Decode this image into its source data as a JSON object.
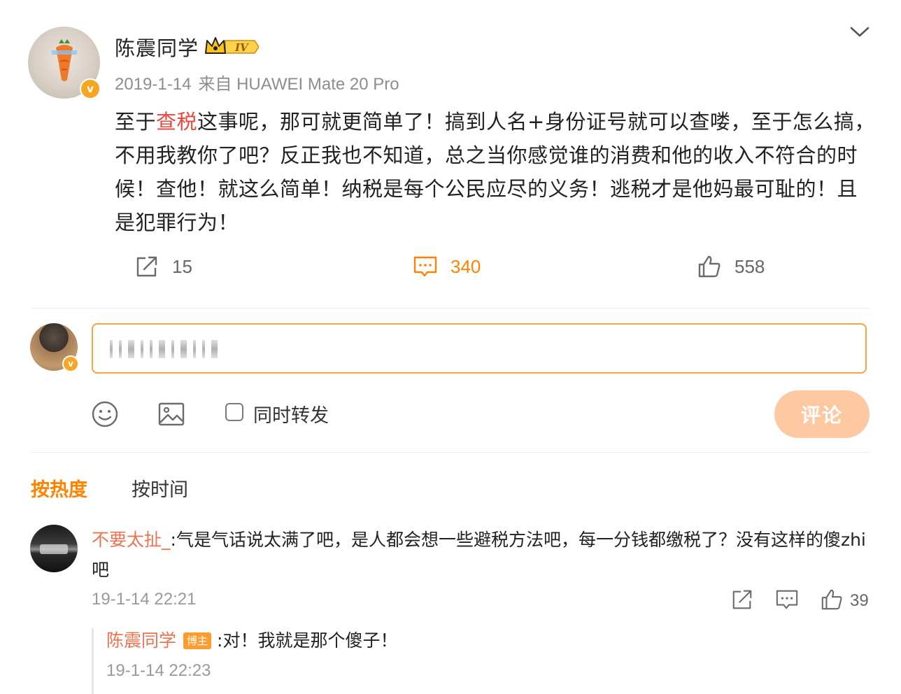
{
  "post": {
    "author": "陈震同学",
    "level_badge": "IV",
    "date": "2019-1-14",
    "source": "来自 HUAWEI Mate 20 Pro",
    "body_prefix": "至于",
    "body_highlight": "查税",
    "body_rest": "这事呢，那可就更简单了！搞到人名+身份证号就可以查喽，至于怎么搞，不用我教你了吧？反正我也不知道，总之当你感觉谁的消费和他的收入不符合的时候！查他！就这么简单！纳税是每个公民应尽的义务！逃税才是他妈最可耻的！且是犯罪行为！",
    "verified_badge": "v"
  },
  "actions": {
    "share_count": "15",
    "comment_count": "340",
    "like_count": "558"
  },
  "composer": {
    "verified_badge": "v",
    "repost_label": "同时转发",
    "submit_label": "评论"
  },
  "sort_tabs": {
    "hot": "按热度",
    "time": "按时间"
  },
  "comments": [
    {
      "user": "不要太扯_",
      "text": ":气是气话说太满了吧，是人都会想一些避税方法吧，每一分钱都缴税了？没有这样的傻zhi吧",
      "time": "19-1-14 22:21",
      "likes": "39",
      "reply": {
        "user": "陈震同学",
        "badge": "博主",
        "text": ":对！我就是那个傻子！",
        "time": "19-1-14 22:23"
      }
    }
  ],
  "colors": {
    "accent": "#ff8200",
    "username": "#eb7350",
    "highlight": "#e8483c",
    "input_border": "#f6a640",
    "submit_disabled": "#fec8a0"
  }
}
